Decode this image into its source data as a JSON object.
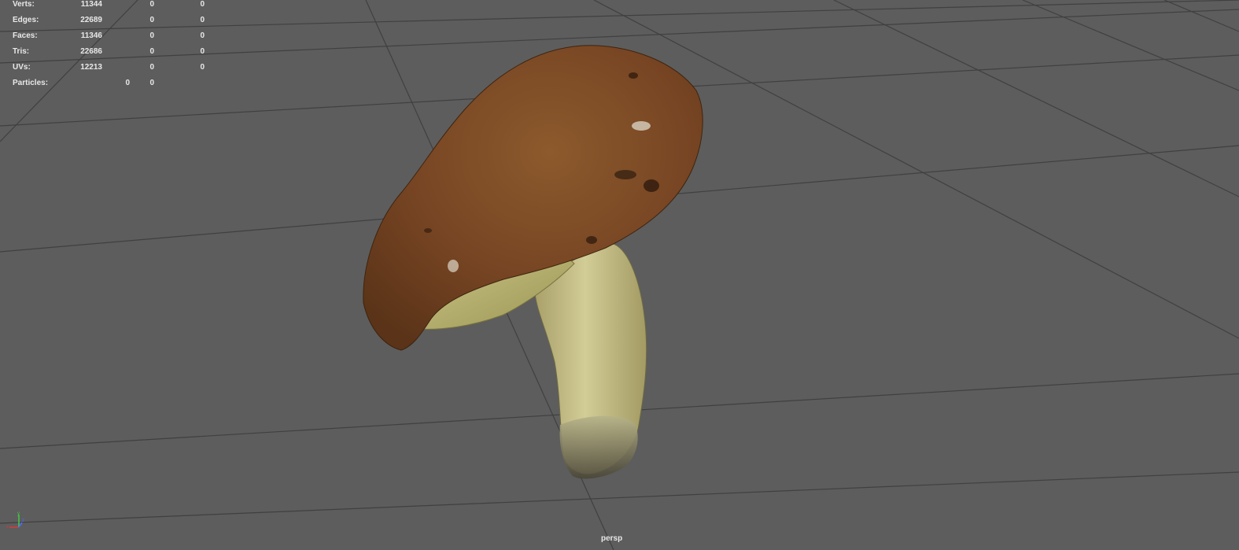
{
  "hud": {
    "rows": [
      {
        "label": "Verts:",
        "c1": "11344",
        "c2": "0",
        "c3": "0"
      },
      {
        "label": "Edges:",
        "c1": "22689",
        "c2": "0",
        "c3": "0"
      },
      {
        "label": "Faces:",
        "c1": "11346",
        "c2": "0",
        "c3": "0"
      },
      {
        "label": "Tris:",
        "c1": "22686",
        "c2": "0",
        "c3": "0"
      },
      {
        "label": "UVs:",
        "c1": "12213",
        "c2": "0",
        "c3": "0"
      },
      {
        "label": "Particles:",
        "c1": "0",
        "c2": "0",
        "c3": ""
      }
    ]
  },
  "viewport": {
    "camera": "persp",
    "background_color": "#5d5d5d",
    "grid_color": "#3f3f3f"
  },
  "axis_gizmo": {
    "labels": [
      "x",
      "y",
      "z"
    ],
    "colors": {
      "x": "#d23b3b",
      "y": "#46c446",
      "z": "#4a6cff"
    }
  },
  "model": {
    "name": "mushroom-model",
    "cap_color": "#7a4a24",
    "stem_color": "#c9c48d"
  }
}
